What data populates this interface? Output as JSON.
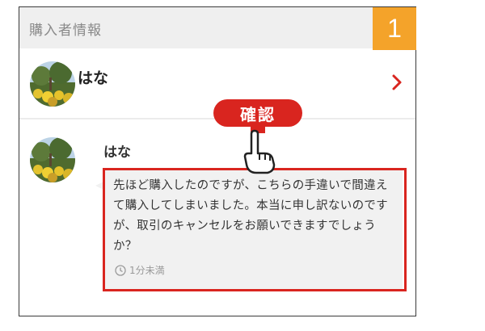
{
  "header": {
    "title": "購入者情報"
  },
  "step": {
    "number": "1"
  },
  "buyer": {
    "name": "はな"
  },
  "message": {
    "sender": "はな",
    "text": "先ほど購入したのですが、こちらの手違いで間違えて購入してしまいました。本当に申し訳ないのですが、取引のキャンセルをお願いできますでしょうか？",
    "time": "1分未満"
  },
  "annotation": {
    "label": "確認"
  },
  "colors": {
    "accent_red": "#d9251f",
    "step_orange": "#f4a32a",
    "header_bg": "#efefef"
  },
  "icons": [
    "chevron-right-icon",
    "clock-icon",
    "pointing-hand-icon"
  ]
}
